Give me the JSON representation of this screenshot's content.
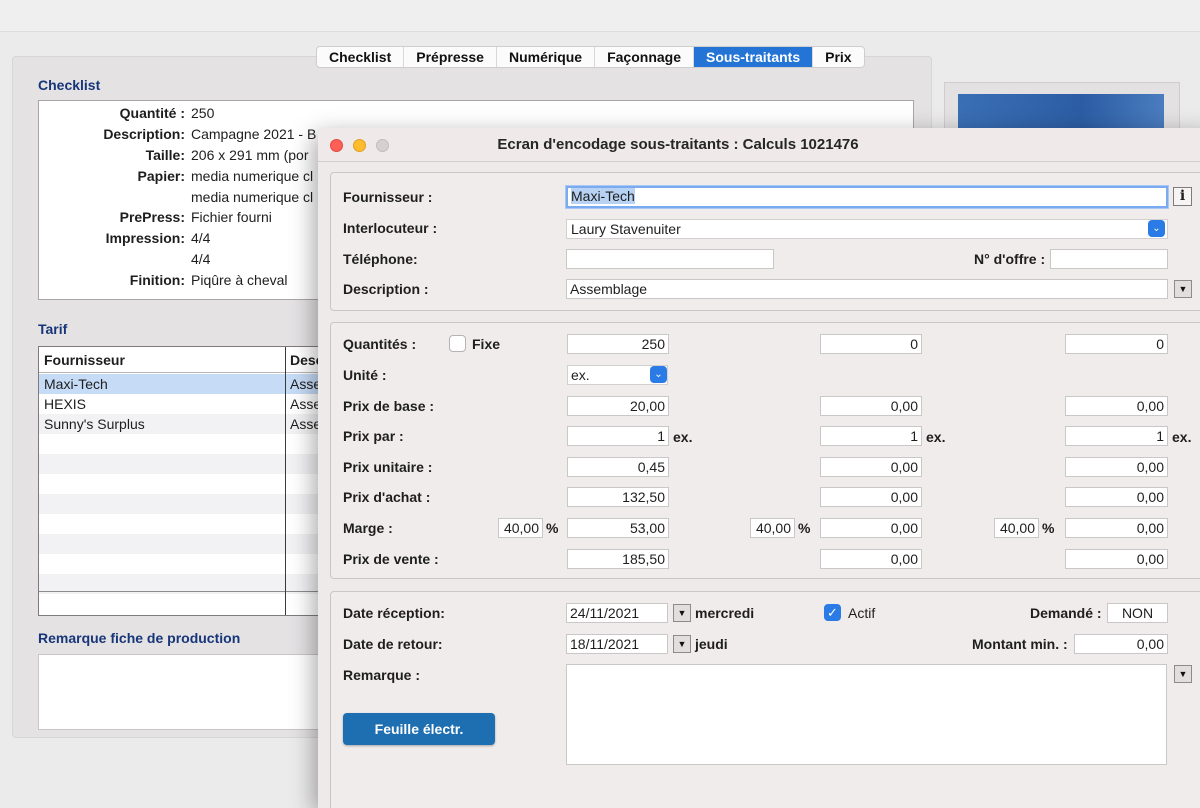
{
  "tabs": [
    "Checklist",
    "Prépresse",
    "Numérique",
    "Façonnage",
    "Sous-traitants",
    "Prix"
  ],
  "active_tab": "Sous-traitants",
  "checklist": {
    "title": "Checklist",
    "rows": [
      {
        "label": "Quantité :",
        "value": "250"
      },
      {
        "label": "Description:",
        "value": "Campagne 2021 - B"
      },
      {
        "label": "Taille:",
        "value": "206 x 291 mm (por"
      },
      {
        "label": "Papier:",
        "value": "media numerique cl"
      },
      {
        "label": "",
        "value": "media numerique cl"
      },
      {
        "label": "PrePress:",
        "value": "Fichier fourni"
      },
      {
        "label": "Impression:",
        "value": "4/4"
      },
      {
        "label": "",
        "value": "4/4"
      },
      {
        "label": "Finition:",
        "value": "Piqûre à cheval"
      }
    ]
  },
  "tarif": {
    "title": "Tarif",
    "columns": [
      "Fournisseur",
      "Desc"
    ],
    "rows": [
      {
        "fournisseur": "Maxi-Tech",
        "desc": "Asse",
        "selected": true
      },
      {
        "fournisseur": "HEXIS",
        "desc": "Asse",
        "selected": false
      },
      {
        "fournisseur": "Sunny's Surplus",
        "desc": "Asse",
        "selected": false
      }
    ]
  },
  "remarque_title": "Remarque fiche de production",
  "dialog": {
    "title": "Ecran d'encodage sous-traitants : Calculs 1021476",
    "supplier": {
      "fournisseur_label": "Fournisseur :",
      "fournisseur_value": "Maxi-Tech",
      "info_label": "i",
      "interlocuteur_label": "Interlocuteur :",
      "interlocuteur_value": "Laury Stavenuiter",
      "telephone_label": "Téléphone:",
      "telephone_value": "",
      "offre_label": "N° d'offre :",
      "offre_value": "",
      "description_label": "Description :",
      "description_value": "Assemblage"
    },
    "pricing": {
      "quantites_label": "Quantités :",
      "fixe_label": "Fixe",
      "unite_label": "Unité :",
      "unite_value": "ex.",
      "unit_suffix": "ex.",
      "pct_suffix": "%",
      "row_labels": {
        "prix_base": "Prix de base :",
        "prix_par": "Prix par :",
        "prix_unitaire": "Prix unitaire :",
        "prix_achat": "Prix d'achat :",
        "marge": "Marge :",
        "prix_vente": "Prix de vente :"
      },
      "columns": [
        {
          "quantite": "250",
          "prix_base": "20,00",
          "prix_par": "1",
          "prix_unitaire": "0,45",
          "prix_achat": "132,50",
          "marge_pct": "40,00",
          "marge": "53,00",
          "prix_vente": "185,50"
        },
        {
          "quantite": "0",
          "prix_base": "0,00",
          "prix_par": "1",
          "prix_unitaire": "0,00",
          "prix_achat": "0,00",
          "marge_pct": "40,00",
          "marge": "0,00",
          "prix_vente": "0,00"
        },
        {
          "quantite": "0",
          "prix_base": "0,00",
          "prix_par": "1",
          "prix_unitaire": "0,00",
          "prix_achat": "0,00",
          "marge_pct": "40,00",
          "marge": "0,00",
          "prix_vente": "0,00"
        }
      ]
    },
    "dates": {
      "reception_label": "Date réception:",
      "reception_value": "24/11/2021",
      "reception_day": "mercredi",
      "actif_label": "Actif",
      "actif_checked": true,
      "demande_label": "Demandé :",
      "demande_value": "NON",
      "retour_label": "Date de retour:",
      "retour_value": "18/11/2021",
      "retour_day": "jeudi",
      "montant_label": "Montant min. :",
      "montant_value": "0,00",
      "remarque_label": "Remarque :",
      "remarque_value": "",
      "sheet_button": "Feuille électr."
    }
  },
  "colors": {
    "accent": "#2474d6",
    "section_title": "#17367a",
    "selection": "#c6dcf6",
    "primary_button": "#1e6fb2"
  }
}
